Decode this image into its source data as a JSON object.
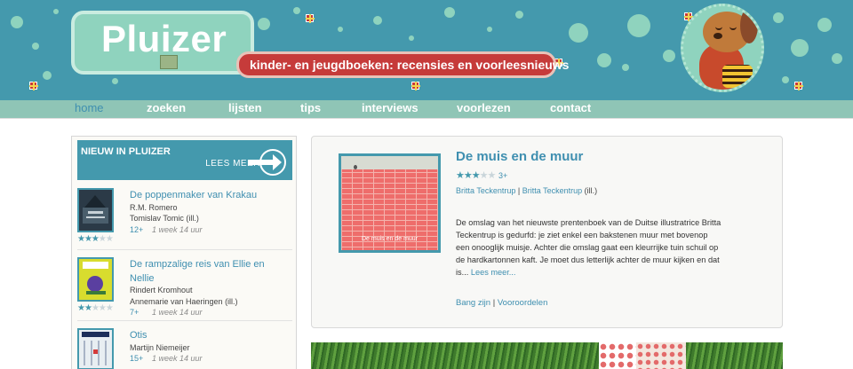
{
  "site": {
    "logo_text": "Pluizer",
    "tagline": "kinder- en jeugdboeken: recensies en voorleesnieuws"
  },
  "nav": {
    "items": [
      {
        "label": "home",
        "active": true
      },
      {
        "label": "zoeken"
      },
      {
        "label": "lijsten"
      },
      {
        "label": "tips"
      },
      {
        "label": "interviews"
      },
      {
        "label": "voorlezen"
      },
      {
        "label": "contact"
      }
    ]
  },
  "sidebar": {
    "title": "NIEUW IN PLUIZER",
    "more_label": "LEES MEER",
    "items": [
      {
        "title": "De poppenmaker van Krakau",
        "author": "R.M. Romero",
        "illustrator": "Tomislav Tomic (ill.)",
        "age": "12+",
        "time": "1 week 14 uur",
        "rating": 3,
        "rating_max": 5,
        "cover_color": "#2b3a47"
      },
      {
        "title": "De rampzalige reis van Ellie en Nellie",
        "author": "Rindert Kromhout",
        "illustrator": "Annemarie van Haeringen (ill.)",
        "age": "7+",
        "time": "1 week 14 uur",
        "rating": 2,
        "rating_max": 5,
        "cover_color": "#d8dc2e"
      },
      {
        "title": "Otis",
        "author": "Martijn Niemeijer",
        "age": "15+",
        "time": "1 week 14 uur",
        "rating": 0,
        "rating_max": 5,
        "cover_color": "#e8eef2"
      }
    ]
  },
  "feature": {
    "title": "De muis en de muur",
    "rating": 3,
    "rating_max": 5,
    "age": "3+",
    "author": "Britta Teckentrup",
    "separator": "|",
    "illustrator": "Britta Teckentrup",
    "illustrator_suffix": "(ill.)",
    "cover_title": "De muis en de muur",
    "description": "De omslag van het nieuwste prentenboek van de Duitse illustratrice Britta Teckentrup is gedurfd: je ziet enkel een bakstenen muur met bovenop een onooglijk muisje. Achter die omslag gaat een kleurrijke tuin schuil op de hardkartonnen kaft. Je moet dus letterlijk achter de muur kijken en dat is...",
    "more_label": "Lees meer...",
    "tags": [
      "Bang zijn",
      "Vooroordelen"
    ]
  },
  "colors": {
    "header_bg": "#4499ad",
    "nav_bg": "#8fc5b6",
    "accent": "#3f8fb0",
    "tagline_red": "#c63b3a",
    "mint": "#8fd3be"
  }
}
